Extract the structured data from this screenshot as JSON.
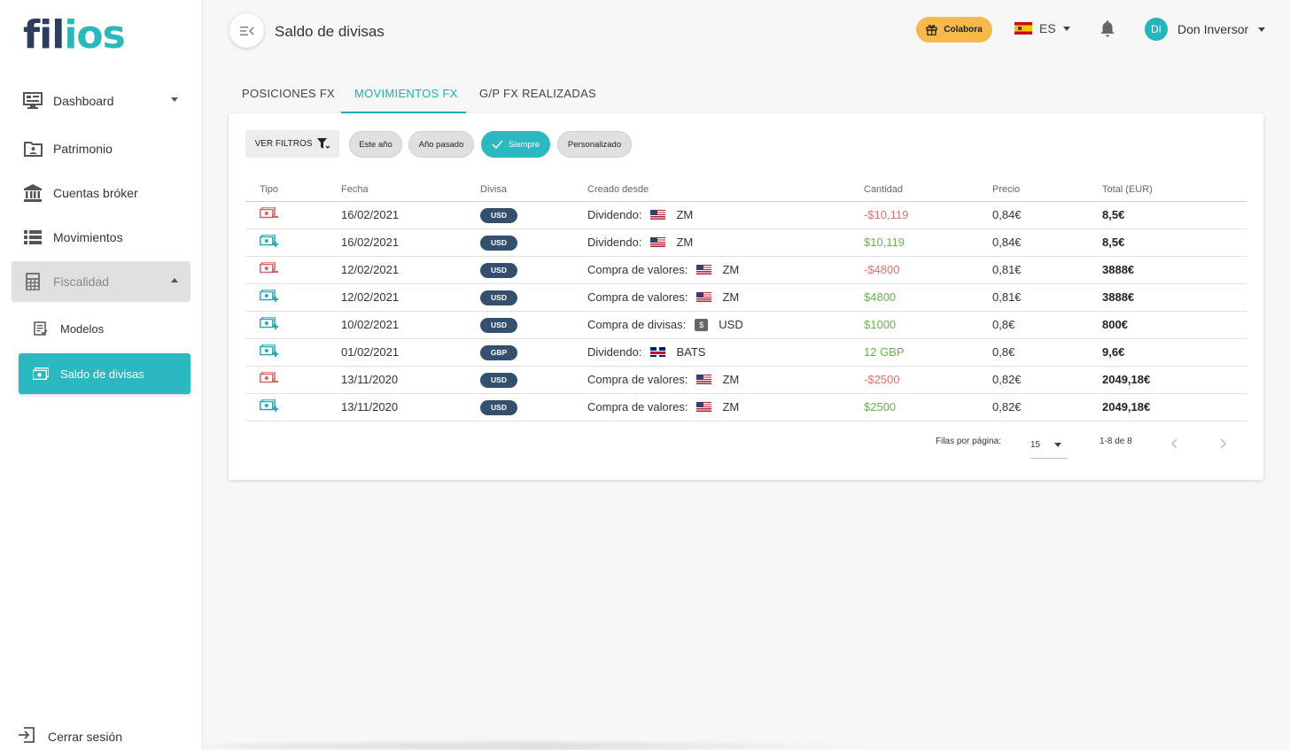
{
  "brand": {
    "logo_part1": "fil",
    "logo_part2": "ios"
  },
  "sidebar": {
    "items": [
      {
        "label": "Dashboard"
      },
      {
        "label": "Patrimonio"
      },
      {
        "label": "Cuentas bróker"
      },
      {
        "label": "Movimientos"
      },
      {
        "label": "Fiscalidad"
      }
    ],
    "sub_items": [
      {
        "label": "Modelos"
      },
      {
        "label": "Saldo de divisas"
      }
    ],
    "logout_label": "Cerrar sesión"
  },
  "header": {
    "title": "Saldo de divisas",
    "colabora_label": "Colabora",
    "language": "ES",
    "user_initials": "DI",
    "user_name": "Don Inversor"
  },
  "tabs": [
    {
      "label": "POSICIONES FX"
    },
    {
      "label": "MOVIMIENTOS FX"
    },
    {
      "label": "G/P FX REALIZADAS"
    }
  ],
  "filters": {
    "button_label": "VER FILTROS",
    "chips": [
      {
        "label": "Este año"
      },
      {
        "label": "Año pasado"
      },
      {
        "label": "Siempre"
      },
      {
        "label": "Personalizado"
      }
    ]
  },
  "table": {
    "headers": [
      "Tipo",
      "Fecha",
      "Divisa",
      "Creado desde",
      "Cantidad",
      "Precio",
      "Total (EUR)"
    ],
    "rows": [
      {
        "fecha": "16/02/2021",
        "divisa": "USD",
        "origen": "Dividendo:",
        "activo": "ZM",
        "cantidad": "-$10,119",
        "precio": "0,84€",
        "total": "8,5€"
      },
      {
        "fecha": "16/02/2021",
        "divisa": "USD",
        "origen": "Dividendo:",
        "activo": "ZM",
        "cantidad": "$10,119",
        "precio": "0,84€",
        "total": "8,5€"
      },
      {
        "fecha": "12/02/2021",
        "divisa": "USD",
        "origen": "Compra de valores:",
        "activo": "ZM",
        "cantidad": "-$4800",
        "precio": "0,81€",
        "total": "3888€"
      },
      {
        "fecha": "12/02/2021",
        "divisa": "USD",
        "origen": "Compra de valores:",
        "activo": "ZM",
        "cantidad": "$4800",
        "precio": "0,81€",
        "total": "3888€"
      },
      {
        "fecha": "10/02/2021",
        "divisa": "USD",
        "origen": "Compra de divisas:",
        "activo": "USD",
        "cantidad": "$1000",
        "precio": "0,8€",
        "total": "800€"
      },
      {
        "fecha": "01/02/2021",
        "divisa": "GBP",
        "origen": "Dividendo:",
        "activo": "BATS",
        "cantidad": "12 GBP",
        "precio": "0,8€",
        "total": "9,6€"
      },
      {
        "fecha": "13/11/2020",
        "divisa": "USD",
        "origen": "Compra de valores:",
        "activo": "ZM",
        "cantidad": "-$2500",
        "precio": "0,82€",
        "total": "2049,18€"
      },
      {
        "fecha": "13/11/2020",
        "divisa": "USD",
        "origen": "Compra de valores:",
        "activo": "ZM",
        "cantidad": "$2500",
        "precio": "0,82€",
        "total": "2049,18€"
      }
    ]
  },
  "pagination": {
    "rows_label": "Filas por página:",
    "rows_value": "15",
    "range": "1-8 de 8"
  },
  "colors": {
    "accent": "#2bb8c0",
    "negative": "#e07070",
    "positive": "#6ab04c",
    "badge": "#34506e",
    "colabora": "#f6b94a"
  }
}
